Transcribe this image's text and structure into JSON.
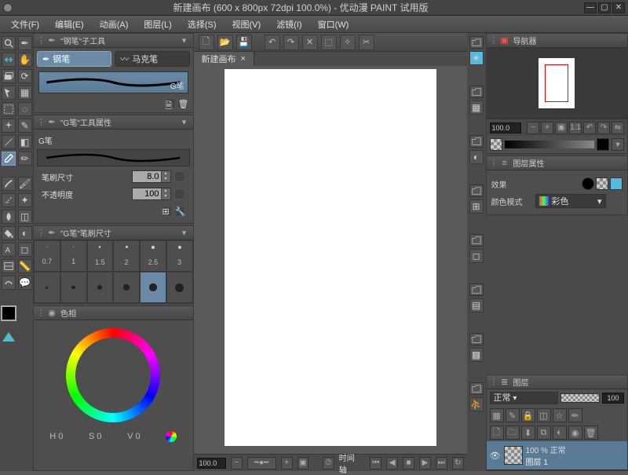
{
  "titlebar": {
    "title": "新建画布 (600 x 800px 72dpi 100.0%)  - 优动漫 PAINT 试用版"
  },
  "menu": [
    "文件(F)",
    "编辑(E)",
    "动画(A)",
    "图层(L)",
    "选择(S)",
    "视图(V)",
    "滤镜(I)",
    "窗口(W)"
  ],
  "subtool": {
    "panel_title": "\"钢笔\"子工具",
    "tabs": [
      {
        "label": "钢笔",
        "selected": true
      },
      {
        "label": "马克笔",
        "selected": false
      }
    ],
    "stroke_label": "G笔"
  },
  "toolprops": {
    "panel_title": "\"G笔\"工具属性",
    "name": "G笔",
    "rows": [
      {
        "label": "笔刷尺寸",
        "value": "8.0"
      },
      {
        "label": "不透明度",
        "value": "100"
      }
    ]
  },
  "brushsize": {
    "panel_title": "\"G笔\"笔刷尺寸",
    "sizes": [
      "0.7",
      "1",
      "1.5",
      "2",
      "2.5",
      "3"
    ],
    "selected_index": 4
  },
  "colorpanel": {
    "panel_title": "色相",
    "readout": {
      "h": "H   0",
      "s": "S   0",
      "v": "V   0"
    }
  },
  "doc_tab": {
    "label": "新建画布",
    "close": "×"
  },
  "status": {
    "zoom": "100.0",
    "timeline_label": "时间轴"
  },
  "navigator": {
    "panel_title": "导航器",
    "zoom": "100.0"
  },
  "layerprops": {
    "panel_title": "图层属性",
    "effect_label": "效果",
    "colormode_label": "颜色模式",
    "colormode_value": "彩色"
  },
  "layers": {
    "panel_title": "图层",
    "blend_mode": "正常",
    "opacity": "100",
    "layer_name": "100 % 正常",
    "layer_sublabel": "图层 1"
  }
}
